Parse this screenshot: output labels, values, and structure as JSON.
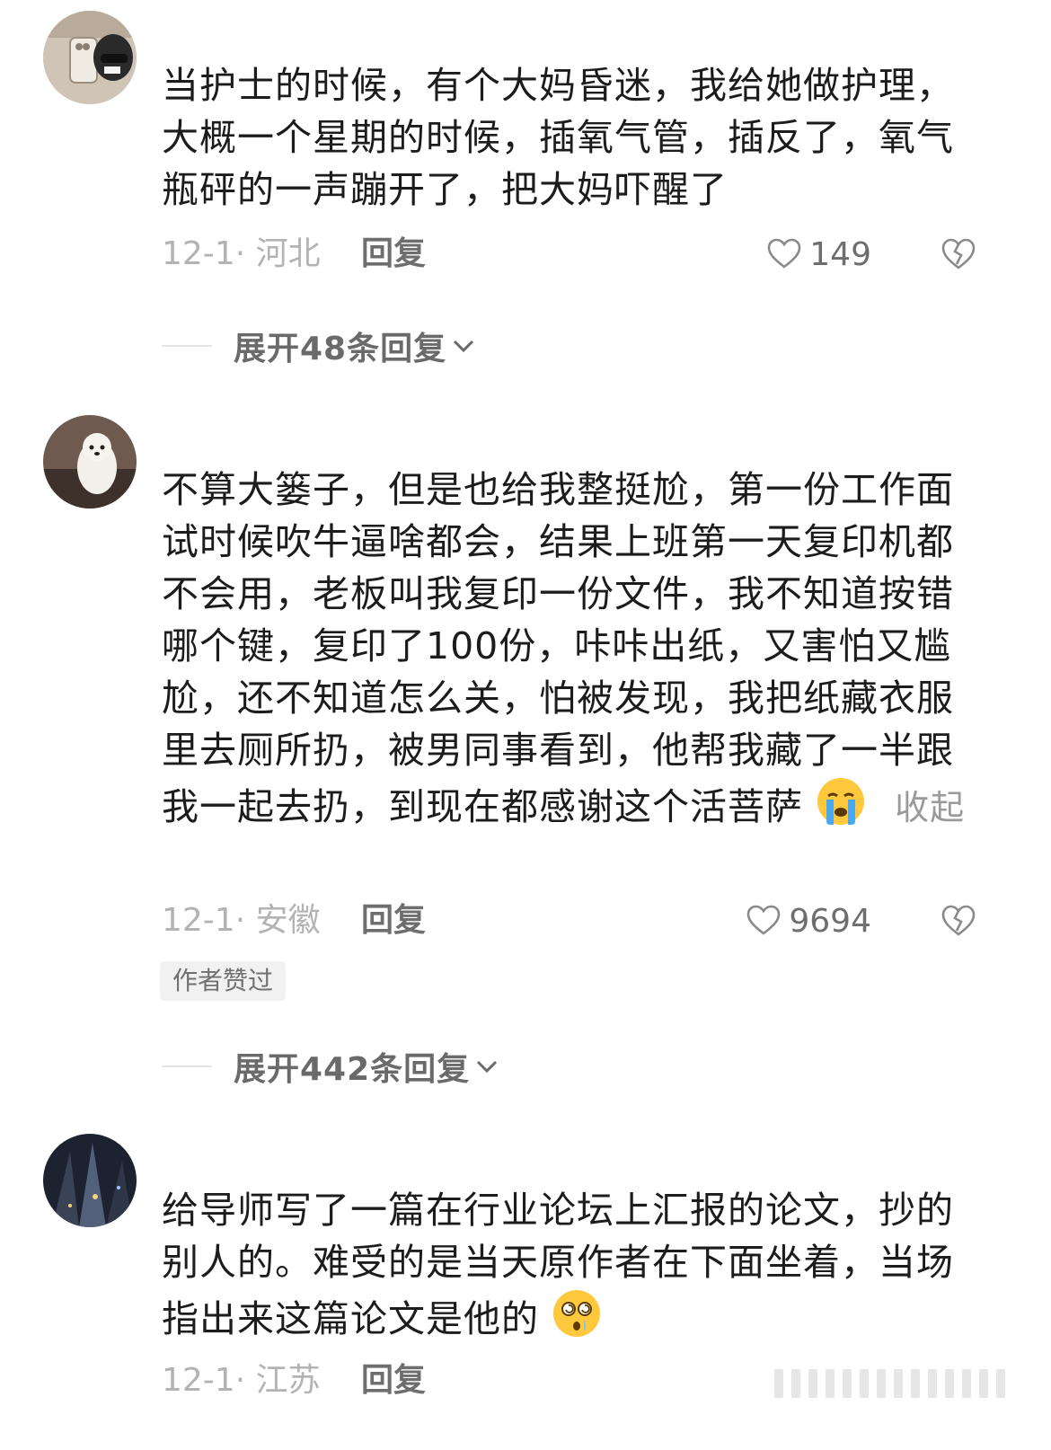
{
  "comments": [
    {
      "text": "当护士的时候，有个大妈昏迷，我给她做护理，大概一个星期的时候，插氧气管，插反了，氧气瓶砰的一声蹦开了，把大妈吓醒了",
      "date_location": "12-1· 河北",
      "reply_label": "回复",
      "likes": "149",
      "expand_label": "展开48条回复"
    },
    {
      "text": "不算大篓子，但是也给我整挺尬，第一份工作面试时候吹牛逼啥都会，结果上班第一天复印机都不会用，老板叫我复印一份文件，我不知道按错哪个键，复印了100份，咔咔出纸，又害怕又尴尬，还不知道怎么关，怕被发现，我把纸藏衣服里去厕所扔，被男同事看到，他帮我藏了一半跟我一起去扔，到现在都感谢这个活菩萨",
      "emoji": "crying-face-emoji",
      "collapse_label": "收起",
      "date_location": "12-1· 安徽",
      "reply_label": "回复",
      "likes": "9694",
      "badge": "作者赞过",
      "expand_label": "展开442条回复"
    },
    {
      "text": "给导师写了一篇在行业论坛上汇报的论文，抄的别人的。难受的是当天原作者在下面坐着，当场指出来这篇论文是他的",
      "emoji": "dizzy-face-emoji",
      "date_location": "12-1· 江苏",
      "reply_label": "回复"
    }
  ],
  "icons": {
    "like": "heart-icon",
    "dislike": "broken-heart-icon",
    "expand": "chevron-down-icon"
  },
  "colors": {
    "text": "#1c1c1c",
    "meta": "#b3b3b3",
    "secondary": "#6e6e6e",
    "badge_bg": "#f1f1f1"
  }
}
